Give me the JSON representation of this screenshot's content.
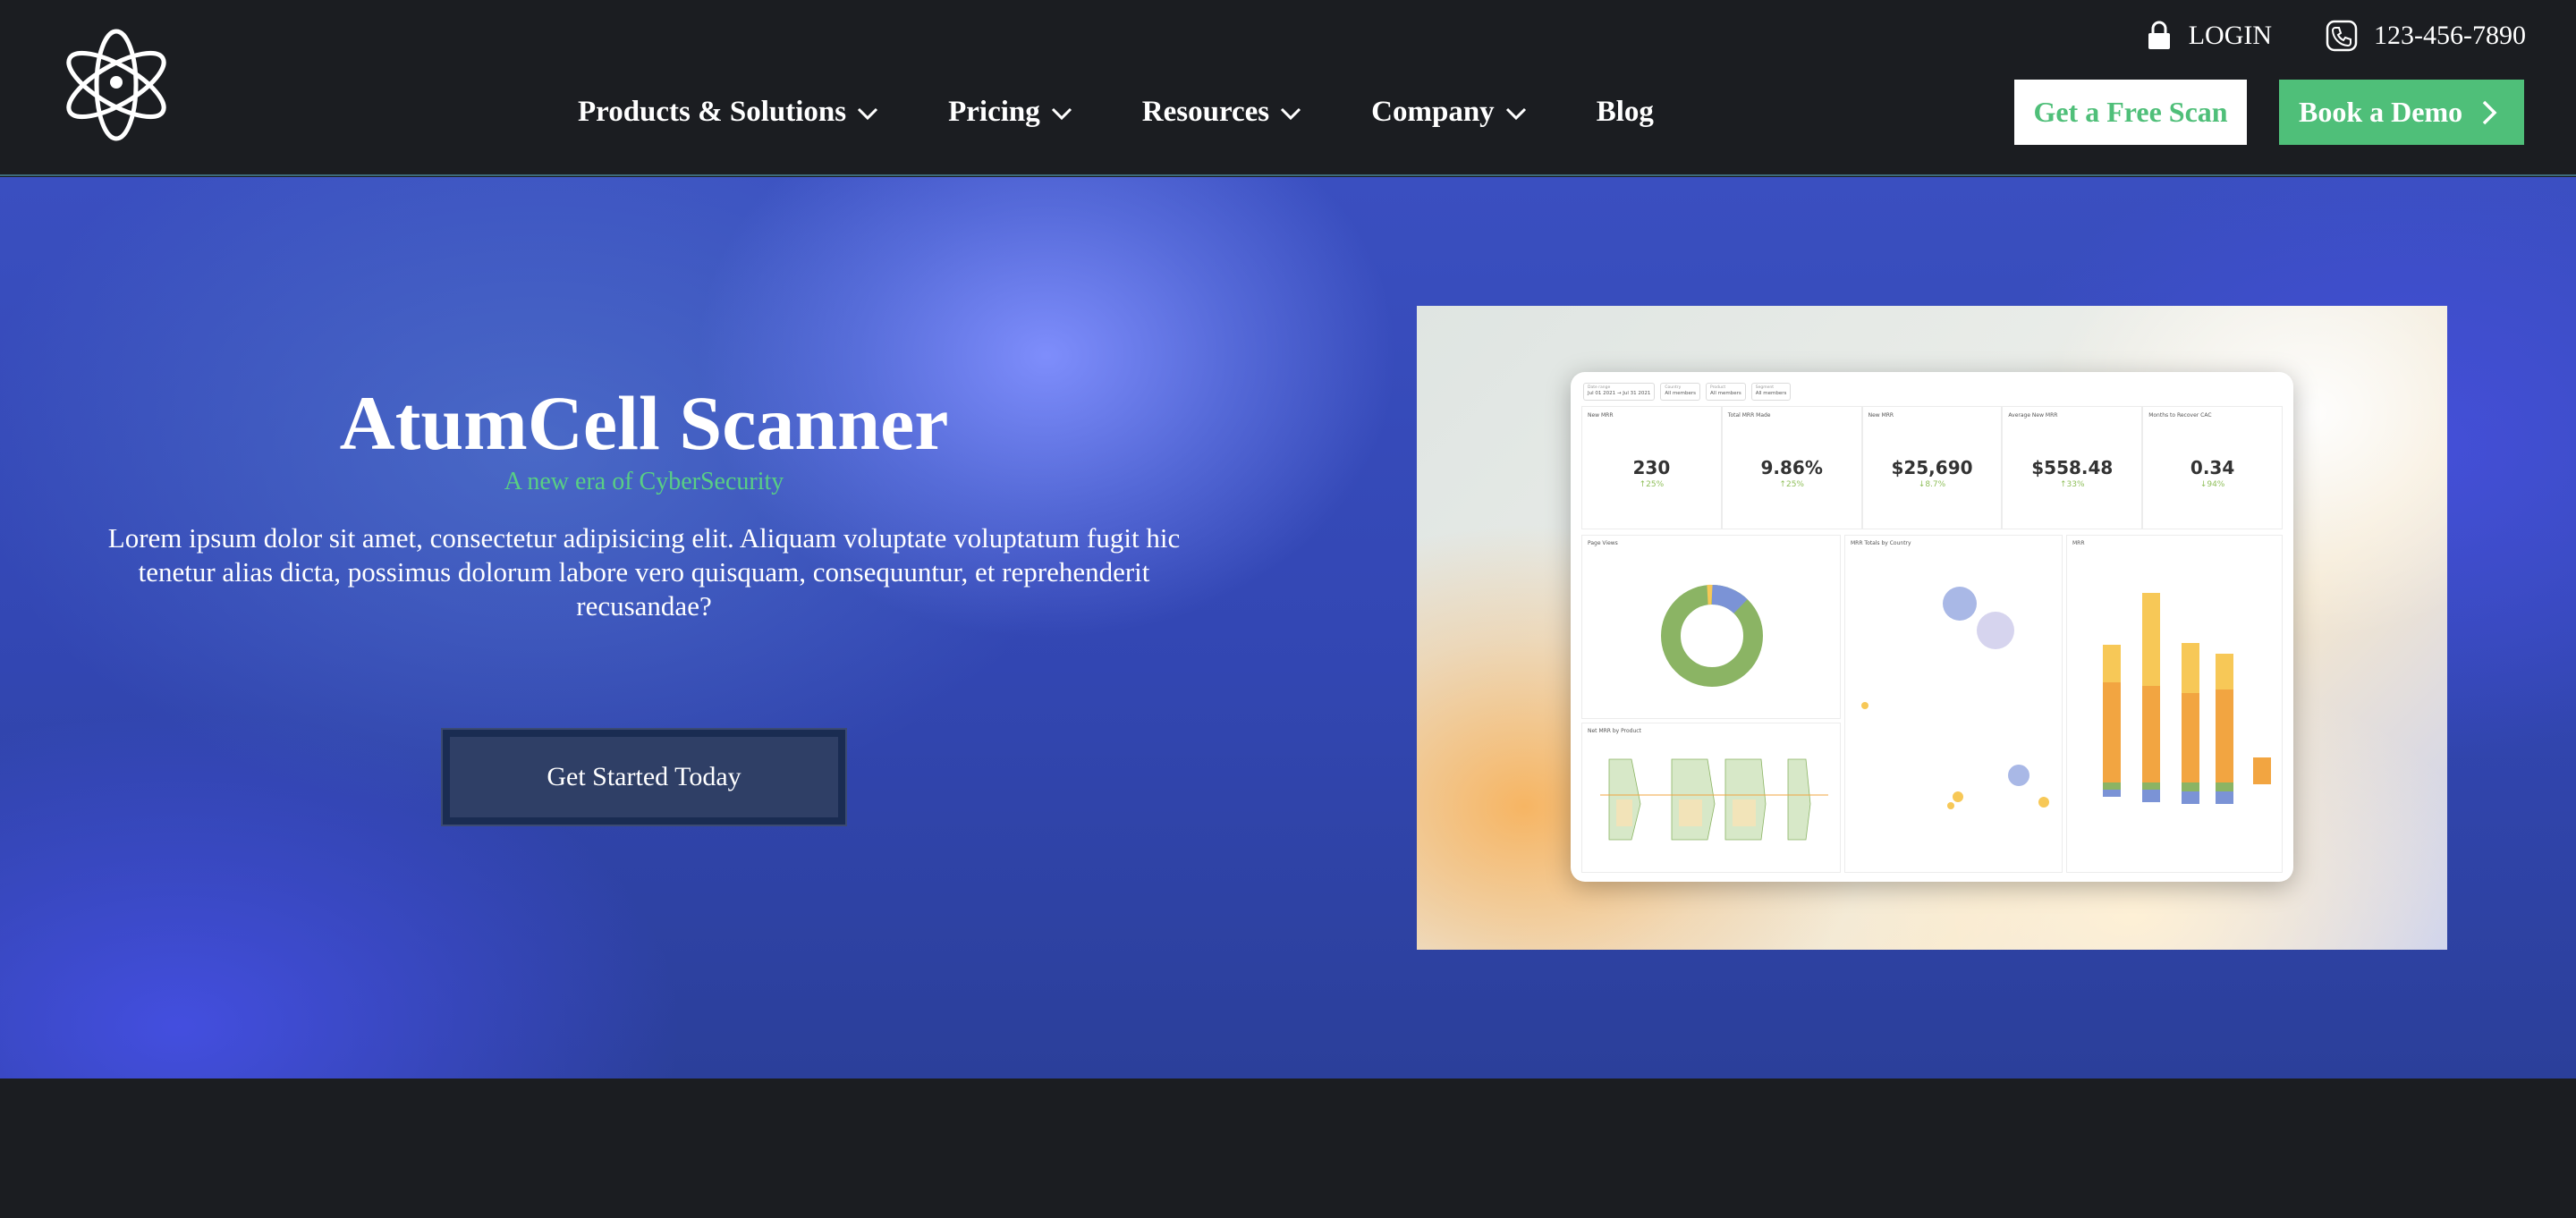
{
  "header": {
    "logo_icon": "atom-logo-icon",
    "login": {
      "icon": "lock-icon",
      "label": "LOGIN"
    },
    "phone": {
      "icon": "phone-icon",
      "label": "123-456-7890"
    },
    "nav": [
      {
        "label": "Products & Solutions",
        "has_dropdown": true
      },
      {
        "label": "Pricing",
        "has_dropdown": true
      },
      {
        "label": "Resources",
        "has_dropdown": true
      },
      {
        "label": "Company",
        "has_dropdown": true
      },
      {
        "label": "Blog",
        "has_dropdown": false
      }
    ],
    "cta_scan": "Get a Free Scan",
    "cta_demo": "Book a Demo"
  },
  "hero": {
    "title": "AtumCell Scanner",
    "tagline": "A new era of CyberSecurity",
    "body": "Lorem ipsum dolor sit amet, consectetur adipisicing elit. Aliquam voluptate voluptatum fugit hic tenetur alias dicta, possimus dolorum labore vero quisquam, consequuntur, et reprehenderit recusandae?",
    "cta": "Get Started Today"
  },
  "dashboard_preview": {
    "filters": [
      {
        "label": "Date range",
        "value": "Jul 01 2021 → Jul 31 2021"
      },
      {
        "label": "Country",
        "value": "All members"
      },
      {
        "label": "Product",
        "value": "All members"
      },
      {
        "label": "Segment",
        "value": "All members"
      }
    ],
    "kpis": [
      {
        "label": "New MRR",
        "value": "230",
        "delta": "↑25%"
      },
      {
        "label": "Total MRR Made",
        "value": "9.86%",
        "delta": "↑25%"
      },
      {
        "label": "New MRR",
        "value": "$25,690",
        "delta": "↓8.7%"
      },
      {
        "label": "Average New MRR",
        "value": "$558.48",
        "delta": "↑33%"
      },
      {
        "label": "Months to Recover CAC",
        "value": "0.34",
        "delta": "↓94%"
      }
    ],
    "panels": {
      "page_views": "Page Views",
      "mrr_by_country": "MRR Totals by Country",
      "mrr": "MRR",
      "net_mrr_by_product": "Net MRR by Product"
    },
    "colors": {
      "green": "#8bb464",
      "blue": "#7b93d6",
      "orange": "#f2a541",
      "yellow": "#f7c857",
      "lavender": "#d6d4ee"
    }
  }
}
